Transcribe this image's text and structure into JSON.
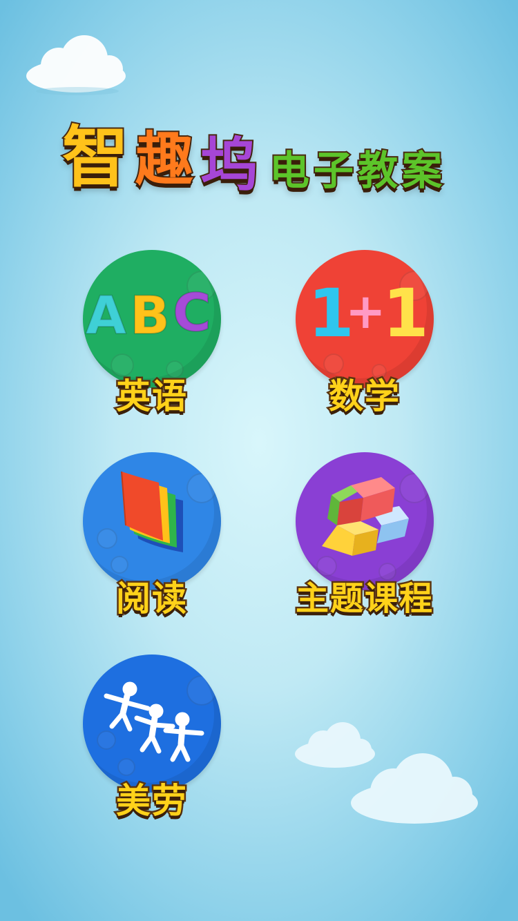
{
  "title": {
    "chars": [
      "智",
      "趣",
      "坞",
      "电",
      "子",
      "教",
      "案"
    ]
  },
  "menu": {
    "items": [
      {
        "label": "英语",
        "icon": "abc-letters-icon",
        "color": "#1fae62"
      },
      {
        "label": "数学",
        "icon": "one-plus-one-icon",
        "color": "#ef4236"
      },
      {
        "label": "阅读",
        "icon": "book-pages-icon",
        "color": "#2f86e6"
      },
      {
        "label": "主题课程",
        "icon": "building-blocks-icon",
        "color": "#8a3fd4"
      },
      {
        "label": "美劳",
        "icon": "paper-people-icon",
        "color": "#1e6fe0"
      }
    ]
  },
  "icons": {
    "abc": [
      "A",
      "B",
      "C"
    ],
    "math": [
      "1",
      "+",
      "1"
    ]
  }
}
